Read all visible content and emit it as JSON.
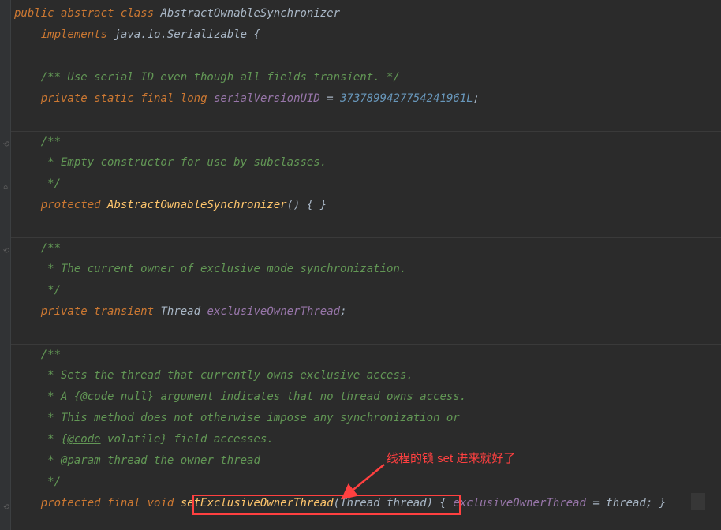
{
  "code": {
    "l1_public": "public",
    "l1_abstract": "abstract",
    "l1_class": "class",
    "l1_name": "AbstractOwnableSynchronizer",
    "l2_impl": "implements",
    "l2_type": "java.io.Serializable",
    "l2_brace": " {",
    "l4_comment": "/** Use serial ID even though all fields transient. */",
    "l5_private": "private",
    "l5_static": "static",
    "l5_final": "final",
    "l5_long": "long",
    "l5_field": "serialVersionUID",
    "l5_eq": " = ",
    "l5_num": "3737899427754241961L",
    "l5_semi": ";",
    "l7_c": "/**",
    "l8_c": " * Empty constructor for use by subclasses.",
    "l9_c": " */",
    "l10_protected": "protected",
    "l10_name": "AbstractOwnableSynchronizer",
    "l10_rest": "() { }",
    "l12_c": "/**",
    "l13_c": " * The current owner of exclusive mode synchronization.",
    "l14_c": " */",
    "l15_private": "private",
    "l15_transient": "transient",
    "l15_type": "Thread",
    "l15_field": "exclusiveOwnerThread",
    "l15_semi": ";",
    "l17_c": "/**",
    "l18_c": " * Sets the thread that currently owns exclusive access.",
    "l19_c1": " * A {",
    "l19_tag": "@code",
    "l19_c2": " null} argument indicates that no thread owns access.",
    "l20_c": " * This method does not otherwise impose any synchronization or",
    "l21_c1": " * {",
    "l21_tag": "@code",
    "l21_c2": " volatile} field accesses.",
    "l22_c1": " * ",
    "l22_tag": "@param",
    "l22_c2": " thread the owner thread",
    "l23_c": " */",
    "l24_protected": "protected",
    "l24_final": "final",
    "l24_void": "void",
    "l24_method": "setExclusiveOwnerThread",
    "l24_p1": "(",
    "l24_ptype": "Thread",
    "l24_pname": " thread",
    "l24_p2": ")",
    "l24_brace": " { ",
    "l24_field": "exclusiveOwnerThread",
    "l24_eq": " = ",
    "l24_val": "thread",
    "l24_end": "; }"
  },
  "annotation": {
    "text": "线程的锁 set 进来就好了"
  }
}
